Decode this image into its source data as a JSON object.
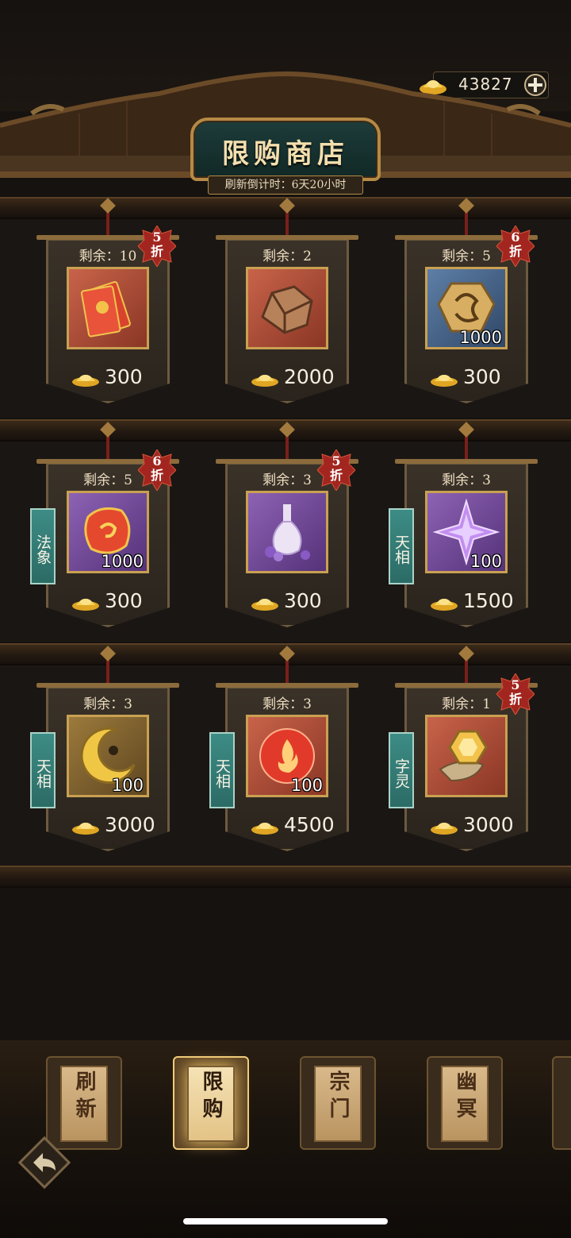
{
  "header": {
    "title": "限购商店",
    "countdown": "刷新倒计时：6天20小时",
    "currency_value": "43827",
    "currency_icon": "gold-ingot-icon",
    "add_icon": "plus-icon"
  },
  "items": [
    {
      "stock": "剩余：10",
      "price": "300",
      "discount": "5 折",
      "qty": "",
      "tag": "",
      "icon": "red-envelope-icon"
    },
    {
      "stock": "剩余：2",
      "price": "2000",
      "discount": "",
      "qty": "",
      "tag": "",
      "icon": "ore-chunk-icon"
    },
    {
      "stock": "剩余：5",
      "price": "300",
      "discount": "6 折",
      "qty": "1000",
      "tag": "",
      "icon": "dragon-medallion-icon"
    },
    {
      "stock": "剩余：5",
      "price": "300",
      "discount": "6 折",
      "qty": "1000",
      "tag": "法象",
      "icon": "red-rune-stone-icon"
    },
    {
      "stock": "剩余：3",
      "price": "300",
      "discount": "5 折",
      "qty": "",
      "tag": "",
      "icon": "purple-vase-icon"
    },
    {
      "stock": "剩余：3",
      "price": "1500",
      "discount": "",
      "qty": "100",
      "tag": "天相",
      "icon": "purple-star-crystal-icon"
    },
    {
      "stock": "剩余：3",
      "price": "3000",
      "discount": "",
      "qty": "100",
      "tag": "天相",
      "icon": "gold-moon-icon"
    },
    {
      "stock": "剩余：3",
      "price": "4500",
      "discount": "",
      "qty": "100",
      "tag": "天相",
      "icon": "fire-orb-icon"
    },
    {
      "stock": "剩余：1",
      "price": "3000",
      "discount": "5 折",
      "qty": "",
      "tag": "字灵",
      "icon": "gold-hexagon-horn-icon"
    }
  ],
  "nav": [
    {
      "label": "刷新",
      "active": false
    },
    {
      "label": "限购",
      "active": true
    },
    {
      "label": "宗门",
      "active": false
    },
    {
      "label": "幽冥",
      "active": false
    }
  ],
  "back_icon": "back-arrow-icon",
  "colors": {
    "gold": "#f2c24a",
    "teal_tag": "#3d8c85",
    "discount_red": "#a2261f"
  }
}
